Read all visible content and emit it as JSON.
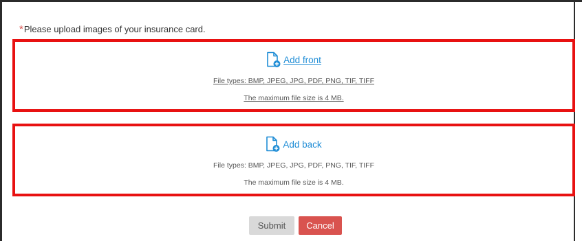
{
  "prompt": {
    "required_marker": "*",
    "text": "Please upload images of your insurance card."
  },
  "front": {
    "icon": "file-add-icon",
    "link_label": "Add front",
    "file_types": "File types: BMP, JPEG, JPG, PDF, PNG, TIF, TIFF",
    "max_size": "The maximum file size is 4 MB."
  },
  "back": {
    "icon": "file-add-icon",
    "link_label": "Add back",
    "file_types": "File types: BMP, JPEG, JPG, PDF, PNG, TIF, TIFF",
    "max_size": "The maximum file size is 4 MB."
  },
  "buttons": {
    "submit": "Submit",
    "cancel": "Cancel"
  },
  "colors": {
    "link": "#1f8dd6",
    "highlight_border": "#e81111",
    "required": "#d9534f",
    "cancel_bg": "#d9534f",
    "submit_bg": "#d9d9d9"
  }
}
